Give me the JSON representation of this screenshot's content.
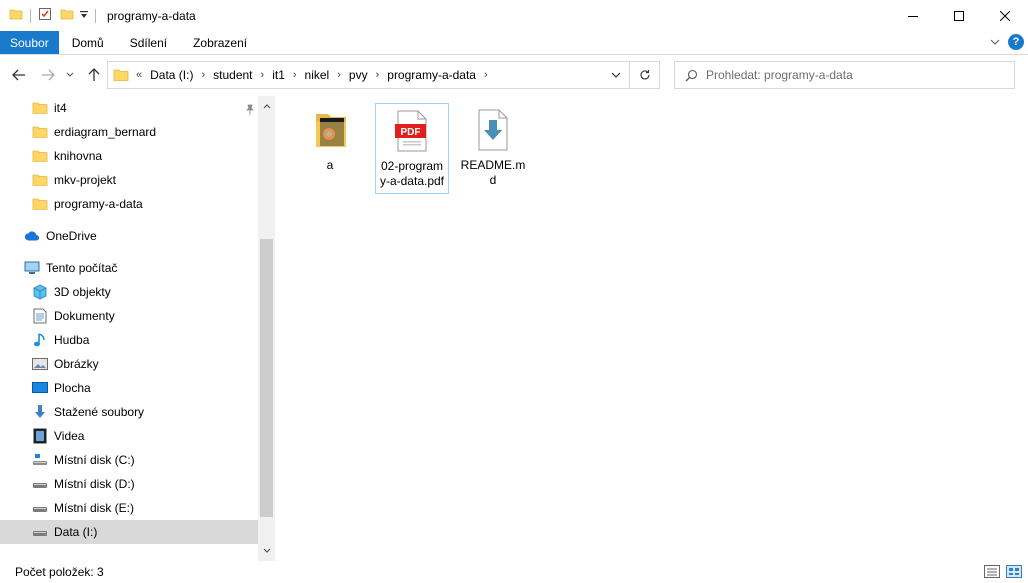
{
  "window": {
    "title": "programy-a-data",
    "icons": [
      "folder-icon",
      "properties-icon",
      "new-folder-icon",
      "customize-dropdown-icon"
    ]
  },
  "ribbon": {
    "tabs": [
      {
        "label": "Soubor"
      },
      {
        "label": "Domů"
      },
      {
        "label": "Sdílení"
      },
      {
        "label": "Zobrazení"
      }
    ]
  },
  "address": {
    "overflow": "«",
    "crumbs": [
      "Data (I:)",
      "student",
      "it1",
      "nikel",
      "pvy",
      "programy-a-data"
    ]
  },
  "search": {
    "placeholder": "Prohledat: programy-a-data"
  },
  "sidebar": {
    "items": [
      {
        "label": "it4",
        "icon": "folder-icon",
        "indent": 1
      },
      {
        "label": "erdiagram_bernard",
        "icon": "folder-icon",
        "indent": 1
      },
      {
        "label": "knihovna",
        "icon": "folder-icon",
        "indent": 1
      },
      {
        "label": "mkv-projekt",
        "icon": "folder-icon",
        "indent": 1
      },
      {
        "label": "programy-a-data",
        "icon": "folder-icon",
        "indent": 1
      },
      {
        "label": "OneDrive",
        "icon": "onedrive-icon",
        "indent": 0
      },
      {
        "label": "Tento počítač",
        "icon": "computer-icon",
        "indent": 0
      },
      {
        "label": "3D objekty",
        "icon": "3d-objects-icon",
        "indent": 1
      },
      {
        "label": "Dokumenty",
        "icon": "documents-icon",
        "indent": 1
      },
      {
        "label": "Hudba",
        "icon": "music-icon",
        "indent": 1
      },
      {
        "label": "Obrázky",
        "icon": "pictures-icon",
        "indent": 1
      },
      {
        "label": "Plocha",
        "icon": "desktop-icon",
        "indent": 1
      },
      {
        "label": "Stažené soubory",
        "icon": "downloads-icon",
        "indent": 1
      },
      {
        "label": "Videa",
        "icon": "videos-icon",
        "indent": 1
      },
      {
        "label": "Místní disk (C:)",
        "icon": "system-drive-icon",
        "indent": 1
      },
      {
        "label": "Místní disk (D:)",
        "icon": "drive-icon",
        "indent": 1
      },
      {
        "label": "Místní disk (E:)",
        "icon": "drive-icon",
        "indent": 1
      },
      {
        "label": "Data (I:)",
        "icon": "drive-icon",
        "indent": 1,
        "selected": true
      }
    ]
  },
  "files": [
    {
      "name": "a",
      "icon": "folder-with-content-icon"
    },
    {
      "name": "02-programy-a-data.pdf",
      "icon": "pdf-file-icon",
      "badge": "PDF",
      "selected": true
    },
    {
      "name": "README.md",
      "icon": "generic-file-icon"
    }
  ],
  "status": {
    "item_count": "Počet položek: 3"
  },
  "colors": {
    "accent": "#1979ca",
    "selection": "#d9d9d9",
    "file_selection_border": "#99d1ff",
    "folder": "#ffd767",
    "pdf_red": "#e02020"
  }
}
